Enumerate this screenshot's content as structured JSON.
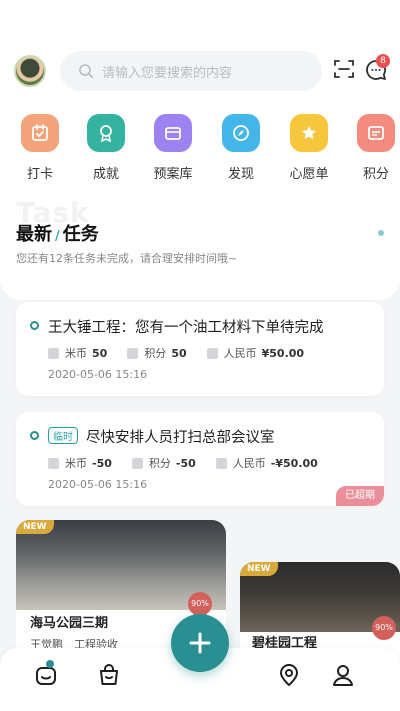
{
  "search": {
    "placeholder": "请输入您要搜索的内容"
  },
  "notifications": {
    "count": "8"
  },
  "categories": [
    {
      "label": "打卡",
      "icon": "checkin-icon",
      "color": "#f08a5d"
    },
    {
      "label": "成就",
      "icon": "medal-icon",
      "color": "#2ab0a0"
    },
    {
      "label": "预案库",
      "icon": "folder-icon",
      "color": "#9b7cf0"
    },
    {
      "label": "发现",
      "icon": "compass-icon",
      "color": "#3fb3e9"
    },
    {
      "label": "心愿单",
      "icon": "star-icon",
      "color": "#f5c33b"
    },
    {
      "label": "积分",
      "icon": "points-icon",
      "color": "#f47a6e"
    }
  ],
  "tasks_section": {
    "bg_word": "Task",
    "title_left": "最新",
    "title_right": "任务",
    "subtitle": "您还有12条任务未完成，请合理安排时间哦~"
  },
  "tasks": [
    {
      "title": "王大锤工程：您有一个油工材料下单待完成",
      "tag": "",
      "mi_label": "米币",
      "mi_value": "50",
      "jf_label": "积分",
      "jf_value": "50",
      "rmb_label": "人民币",
      "rmb_value": "¥50.00",
      "date": "2020-05-06 15:16",
      "status": ""
    },
    {
      "title": "尽快安排人员打扫总部会议室",
      "tag": "临时",
      "mi_label": "米币",
      "mi_value": "-50",
      "jf_label": "积分",
      "jf_value": "-50",
      "rmb_label": "人民币",
      "rmb_value": "-¥50.00",
      "date": "2020-05-06 15:16",
      "status": "已超期"
    }
  ],
  "projects": [
    {
      "badge": "NEW",
      "name": "海马公园三期",
      "sub": "王觉鹏　工程验收",
      "percent": "90%"
    },
    {
      "badge": "NEW",
      "name": "碧桂园工程",
      "sub": "",
      "percent": "90%"
    }
  ],
  "colors": {
    "primary": "#2a8f93",
    "overdue": "#ea8f9a",
    "accent_new": "#d9a93c"
  }
}
